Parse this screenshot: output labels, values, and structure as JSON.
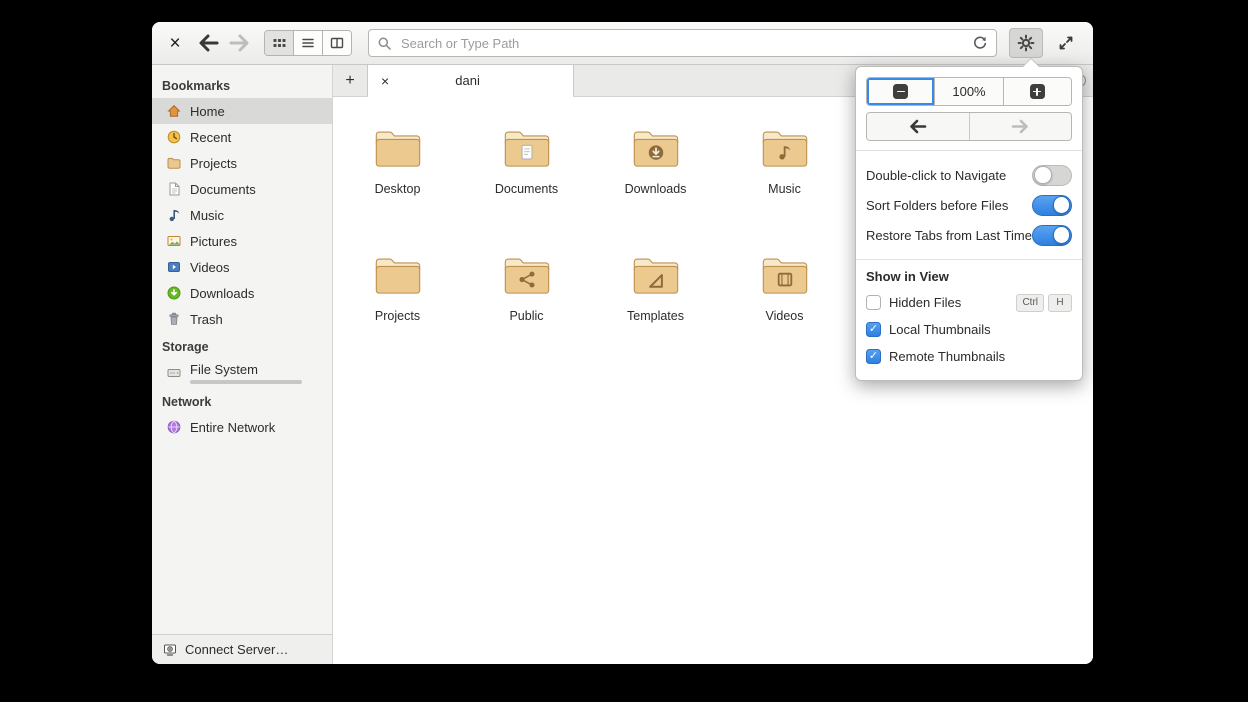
{
  "glyphs": {
    "close": "×",
    "plus": "+",
    "check": "✓"
  },
  "header": {
    "search_placeholder": "Search or Type Path"
  },
  "tabbar": {
    "tab_label": "dani"
  },
  "sidebar": {
    "bookmarks_title": "Bookmarks",
    "bookmarks": [
      "Home",
      "Recent",
      "Projects",
      "Documents",
      "Music",
      "Pictures",
      "Videos",
      "Downloads",
      "Trash"
    ],
    "storage_title": "Storage",
    "storage_items": [
      "File System"
    ],
    "network_title": "Network",
    "network_items": [
      "Entire Network"
    ],
    "connect_server": "Connect Server…"
  },
  "files": {
    "labels": [
      "Desktop",
      "Documents",
      "Downloads",
      "Music",
      "Projects",
      "Public",
      "Templates",
      "Videos"
    ]
  },
  "popover": {
    "zoom_value": "100%",
    "switches": [
      {
        "label": "Double-click to Navigate",
        "on": false
      },
      {
        "label": "Sort Folders before Files",
        "on": true
      },
      {
        "label": "Restore Tabs from Last Time",
        "on": true
      }
    ],
    "show_in_view": "Show in View",
    "hidden_files": {
      "label": "Hidden Files",
      "checked": false,
      "shortcut": [
        "Ctrl",
        "H"
      ]
    },
    "local_thumbnails": {
      "label": "Local Thumbnails",
      "checked": true
    },
    "remote_thumbnails": {
      "label": "Remote Thumbnails",
      "checked": true
    }
  },
  "colors": {
    "accent": "#3689e6",
    "folder_front": "#ebc98f",
    "folder_back": "#f7e9c8",
    "emblem": "#8d6b3a"
  }
}
